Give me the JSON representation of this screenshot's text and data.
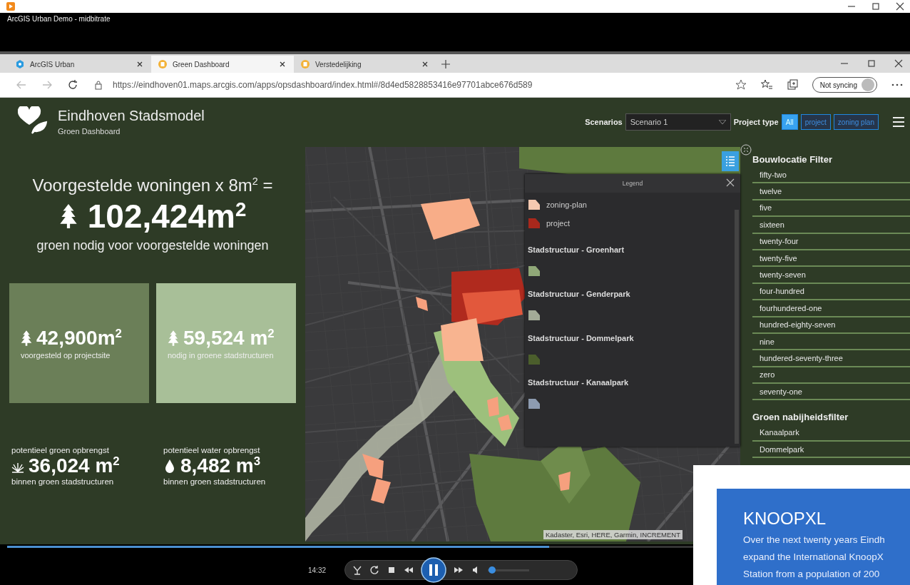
{
  "player": {
    "title": "ArcGIS Urban Demo - midbitrate",
    "time": "14:32",
    "progress": {
      "level": 0.6
    },
    "volume": {
      "level": 0.1
    }
  },
  "browser": {
    "tabs": [
      {
        "label": "ArcGIS Urban",
        "selected": false
      },
      {
        "label": "Green Dashboard",
        "selected": true
      },
      {
        "label": "Verstedelijking",
        "selected": false
      }
    ],
    "url": "https://eindhoven01.maps.arcgis.com/apps/opsdashboard/index.html#/8d4ed5828853416e97701abce676d589",
    "sync_label": "Not syncing"
  },
  "dashboard": {
    "title": "Eindhoven Stadsmodel",
    "subtitle": "Groen Dashboard",
    "scenarios_label": "Scenarios",
    "scenario": "Scenario 1",
    "project_type_label": "Project type",
    "project_types": [
      {
        "label": "All",
        "selected": true
      },
      {
        "label": "project",
        "selected": false
      },
      {
        "label": "zoning plan",
        "selected": false
      }
    ]
  },
  "summary": {
    "heading": "Voorgestelde woningen x 8m$^{2}$ =",
    "total": "102,424m$^{2}$",
    "caption": "groen nodig voor voorgestelde woningen"
  },
  "cards": [
    {
      "value": "42,900m$^{2}$",
      "caption": "voorgesteld op projectsite",
      "color": "#6b7f58"
    },
    {
      "value": "59,524 m$^{2}$",
      "caption": "nodig in groene stadstructuren",
      "color": "#a8bf98"
    }
  ],
  "yields": [
    {
      "kind": "green",
      "heading": "potentieel groen opbrengst",
      "value": "36,024 m$^{2}$",
      "caption": "binnen groen stadstructuren"
    },
    {
      "kind": "water",
      "heading": "potentieel water opbrengst",
      "value": "8,482 m$^{3}$",
      "caption": "binnen groen stadstructuren"
    }
  ],
  "map": {
    "attribution": "Kadaster, Esri, HERE, Garmin, INCREMENT"
  },
  "legend": {
    "title": "Legend",
    "items": [
      {
        "label": "zoning-plan",
        "color": "#f5c9b0"
      },
      {
        "label": "project",
        "color": "#a8281c"
      }
    ],
    "groups": [
      {
        "heading": "Stadstructuur - Groenhart",
        "color": "#90a878"
      },
      {
        "heading": "Stadstructuur - Genderpark",
        "color": "#a3ab97"
      },
      {
        "heading": "Stadstructuur - Dommelpark",
        "color": "#4b5e2c"
      },
      {
        "heading": "Stadstructuur - Kanaalpark",
        "color": "#8d9bb0"
      }
    ]
  },
  "filters": [
    {
      "title": "Bouwlocatie Filter",
      "items": [
        "fifty-two",
        "twelve",
        "five",
        "sixteen",
        "twenty-four",
        "twenty-five",
        "twenty-seven",
        "four-hundred",
        "fourhundered-one",
        "hundred-eighty-seven",
        "nine",
        "hundered-seventy-three",
        "zero",
        "seventy-one"
      ]
    },
    {
      "title": "Groen nabijheidsfilter",
      "items": [
        "Kanaalpark",
        "Dommelpark"
      ]
    }
  ],
  "promo": {
    "title": "KNOOPXL",
    "lines": [
      "Over the next twenty years Eindh",
      "expand the International KnoopX",
      "Station from a population of 200"
    ]
  }
}
